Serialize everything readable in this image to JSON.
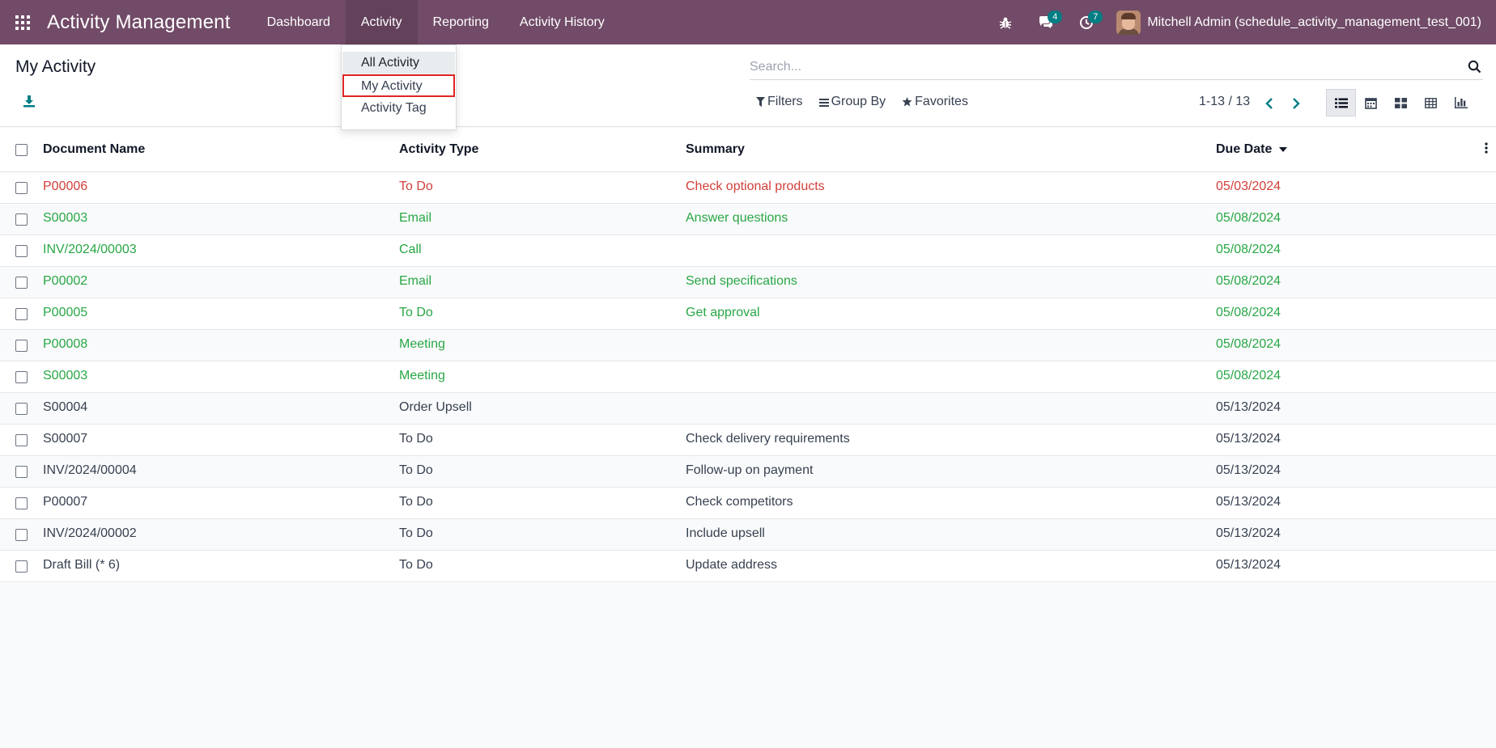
{
  "navbar": {
    "app_title": "Activity Management",
    "menu": [
      "Dashboard",
      "Activity",
      "Reporting",
      "Activity History"
    ],
    "messages_count": "4",
    "activities_count": "7",
    "user_name": "Mitchell Admin (schedule_activity_management_test_001)",
    "bg_color": "#714b67"
  },
  "activity_menu": {
    "items": [
      "All Activity",
      "My Activity",
      "Activity Tag"
    ],
    "highlighted": "My Activity"
  },
  "control": {
    "page_title": "My Activity",
    "search_placeholder": "Search...",
    "filters_label": "Filters",
    "group_by_label": "Group By",
    "favorites_label": "Favorites",
    "pager": "1-13 / 13"
  },
  "table": {
    "columns": [
      "Document Name",
      "Activity Type",
      "Summary",
      "Due Date"
    ],
    "sort_column": "Due Date",
    "rows": [
      {
        "doc": "P00006",
        "type": "To Do",
        "summary": "Check optional products",
        "due": "05/03/2024",
        "status": "overdue"
      },
      {
        "doc": "S00003",
        "type": "Email",
        "summary": "Answer questions",
        "due": "05/08/2024",
        "status": "today"
      },
      {
        "doc": "INV/2024/00003",
        "type": "Call",
        "summary": "",
        "due": "05/08/2024",
        "status": "today"
      },
      {
        "doc": "P00002",
        "type": "Email",
        "summary": "Send specifications",
        "due": "05/08/2024",
        "status": "today"
      },
      {
        "doc": "P00005",
        "type": "To Do",
        "summary": "Get approval",
        "due": "05/08/2024",
        "status": "today"
      },
      {
        "doc": "P00008",
        "type": "Meeting",
        "summary": "",
        "due": "05/08/2024",
        "status": "today"
      },
      {
        "doc": "S00003",
        "type": "Meeting",
        "summary": "",
        "due": "05/08/2024",
        "status": "today"
      },
      {
        "doc": "S00004",
        "type": "Order Upsell",
        "summary": "",
        "due": "05/13/2024",
        "status": "planned"
      },
      {
        "doc": "S00007",
        "type": "To Do",
        "summary": "Check delivery requirements",
        "due": "05/13/2024",
        "status": "planned"
      },
      {
        "doc": "INV/2024/00004",
        "type": "To Do",
        "summary": "Follow-up on payment",
        "due": "05/13/2024",
        "status": "planned"
      },
      {
        "doc": "P00007",
        "type": "To Do",
        "summary": "Check competitors",
        "due": "05/13/2024",
        "status": "planned"
      },
      {
        "doc": "INV/2024/00002",
        "type": "To Do",
        "summary": "Include upsell",
        "due": "05/13/2024",
        "status": "planned"
      },
      {
        "doc": "Draft Bill (* 6)",
        "type": "To Do",
        "summary": "Update address",
        "due": "05/13/2024",
        "status": "planned"
      }
    ]
  },
  "status_colors": {
    "overdue": "#d23f3a",
    "today": "#28a745",
    "planned": "#374151"
  }
}
